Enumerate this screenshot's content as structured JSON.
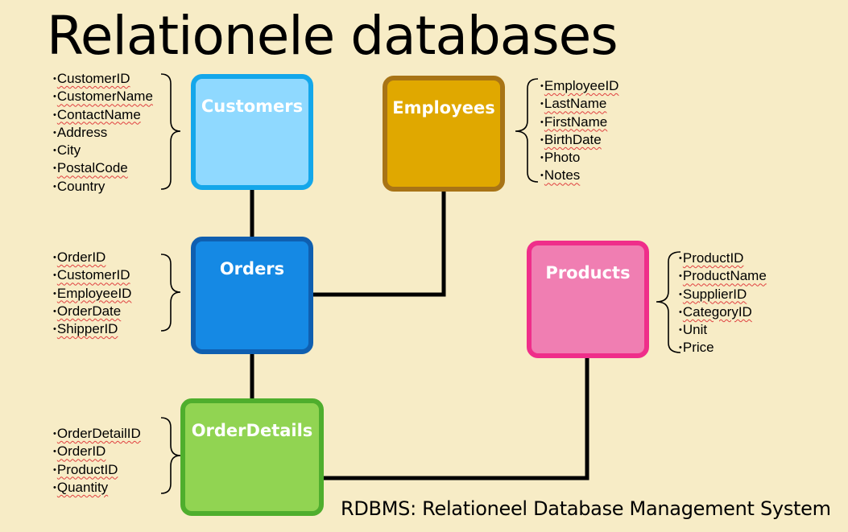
{
  "title": "Relationele databases",
  "tables": {
    "customers": {
      "name": "Customers",
      "fields": [
        "CustomerID",
        "CustomerName",
        "ContactName",
        "Address",
        "City",
        "PostalCode",
        "Country"
      ]
    },
    "employees": {
      "name": "Employees",
      "fields": [
        "EmployeeID",
        "LastName",
        "FirstName",
        "BirthDate",
        "Photo",
        "Notes"
      ]
    },
    "orders": {
      "name": "Orders",
      "fields": [
        "OrderID",
        "CustomerID",
        "EmployeeID",
        "OrderDate",
        "ShipperID"
      ]
    },
    "products": {
      "name": "Products",
      "fields": [
        "ProductID",
        "ProductName",
        "SupplierID",
        "CategoryID",
        "Unit",
        "Price"
      ]
    },
    "orderdetails": {
      "name": "OrderDetails",
      "fields": [
        "OrderDetailID",
        "OrderID",
        "ProductID",
        "Quantity"
      ]
    }
  },
  "footer": "RDBMS: Relationeel Database Management System",
  "colors": {
    "background": "#f7ecc6",
    "customers": "#8fd9ff",
    "employees": "#e0a800",
    "orders": "#1589e4",
    "products": "#f07eb2",
    "orderdetails": "#91d452"
  }
}
